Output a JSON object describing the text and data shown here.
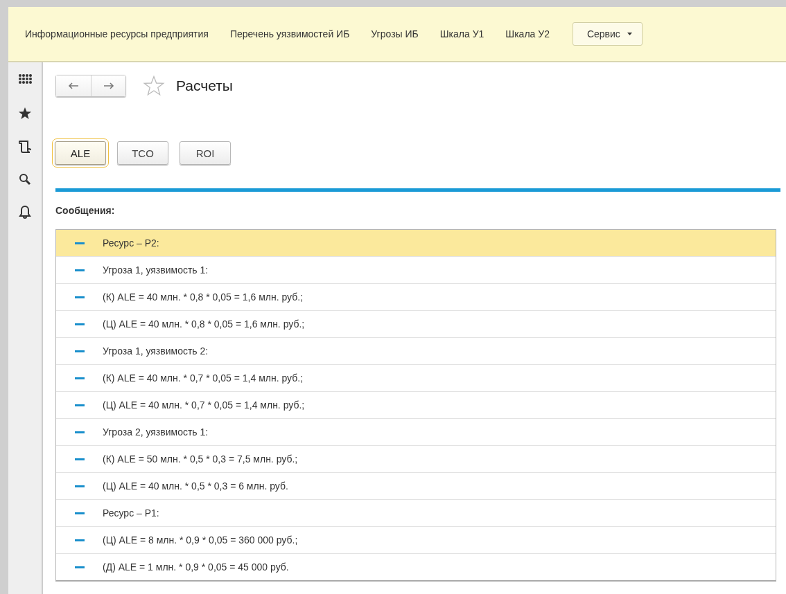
{
  "nav": {
    "items": [
      {
        "label": "Информационные ресурсы предприятия",
        "kind": "link"
      },
      {
        "label": "Перечень уязвимостей ИБ",
        "kind": "link"
      },
      {
        "label": "Угрозы ИБ",
        "kind": "link"
      },
      {
        "label": "Шкала У1",
        "kind": "link"
      },
      {
        "label": "Шкала У2",
        "kind": "link"
      },
      {
        "label": "Сервис",
        "kind": "dropdown"
      }
    ]
  },
  "page": {
    "title": "Расчеты",
    "favorite": false
  },
  "buttons": [
    {
      "label": "ALE",
      "focused": true
    },
    {
      "label": "TCO",
      "focused": false
    },
    {
      "label": "ROI",
      "focused": false
    }
  ],
  "messages": {
    "title": "Сообщения:",
    "items": [
      {
        "text": "Ресурс – Р2:",
        "selected": true
      },
      {
        "text": "Угроза 1, уязвимость 1:",
        "selected": false
      },
      {
        "text": "(К) ALE = 40 млн. * 0,8 * 0,05 = 1,6 млн. руб.;",
        "selected": false
      },
      {
        "text": "(Ц) ALE = 40 млн. * 0,8 * 0,05 = 1,6 млн. руб.;",
        "selected": false
      },
      {
        "text": "Угроза 1, уязвимость 2:",
        "selected": false
      },
      {
        "text": "(К) ALE = 40 млн. * 0,7 * 0,05 = 1,4 млн. руб.;",
        "selected": false
      },
      {
        "text": "(Ц) ALE = 40 млн. * 0,7 * 0,05 = 1,4 млн. руб.;",
        "selected": false
      },
      {
        "text": "Угроза 2, уязвимость 1:",
        "selected": false
      },
      {
        "text": "(К) ALE = 50 млн. * 0,5 * 0,3 = 7,5 млн. руб.;",
        "selected": false
      },
      {
        "text": "(Ц) ALE = 40 млн. * 0,5 * 0,3 = 6 млн. руб.",
        "selected": false
      },
      {
        "text": "Ресурс – Р1:",
        "selected": false
      },
      {
        "text": "(Ц) ALE = 8 млн. * 0,9 * 0,05 = 360 000 руб.;",
        "selected": false
      },
      {
        "text": "(Д) ALE = 1 млн. * 0,9 * 0,05 = 45 000 руб.",
        "selected": false
      }
    ]
  }
}
